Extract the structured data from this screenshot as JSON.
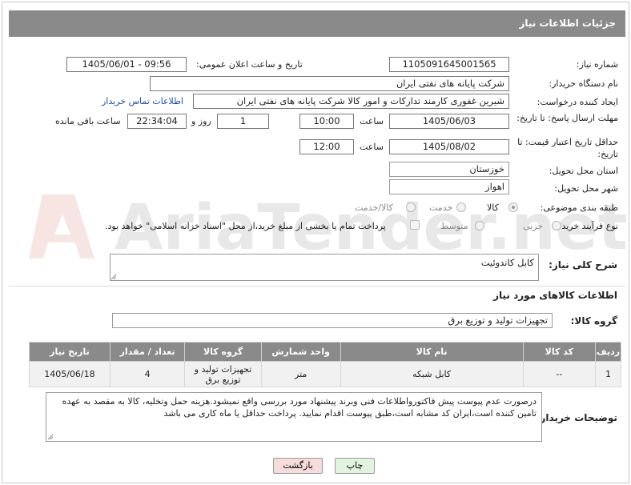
{
  "header": {
    "title": "جزئیات اطلاعات نیاز"
  },
  "form": {
    "need_number_label": "شماره نیاز:",
    "need_number": "1105091645001565",
    "announce_label": "تاریخ و ساعت اعلان عمومی:",
    "announce_value": "1405/06/01 - 09:56",
    "buyer_label": "نام دستگاه خریدار:",
    "buyer_value": "شرکت پایانه های نفتی ایران",
    "creator_label": "ایجاد کننده درخواست:",
    "creator_value": "شیرین غفوری کارمند تدارکات و امور کالا شرکت پایانه های نفتی ایران",
    "buyer_contact_link": "اطلاعات تماس خریدار",
    "reply_deadline_label": "مهلت ارسال پاسخ: تا تاریخ:",
    "reply_date": "1405/06/03",
    "time_label": "ساعت",
    "reply_time": "10:00",
    "days_value": "1",
    "days_label": "روز و",
    "remaining_time": "22:34:04",
    "remaining_label": "ساعت باقی مانده",
    "price_validity_label": "حداقل تاریخ اعتبار قیمت: تا تاریخ:",
    "price_date": "1405/08/02",
    "price_time_label": "ساعت",
    "price_time": "12:00",
    "province_label": "استان محل تحویل:",
    "province_value": "خوزستان",
    "city_label": "شهر محل تحویل:",
    "city_value": "اهواز",
    "category_label": "طبقه بندی موضوعی:",
    "category_options": [
      "کالا",
      "خدمت",
      "کالا/خدمت"
    ],
    "category_selected": "کالا",
    "process_label": "نوع فرآیند خرید :",
    "process_options": [
      "جزیی",
      "متوسط"
    ],
    "payment_note": "پرداخت تمام یا بخشی از مبلغ خرید،از محل \"اسناد خزانه اسلامی\" خواهد بود.",
    "description_label": "شرح کلی نیاز:",
    "description_value": "کابل کاندوئیت",
    "goods_info_label": "اطلاعات کالاهای مورد نیاز",
    "goods_group_label": "گروه کالا:",
    "goods_group_value": "تجهیزات تولید و توزیع برق"
  },
  "table": {
    "headers": [
      "ردیف",
      "کد کالا",
      "نام کالا",
      "واحد شمارش",
      "گروه کالا",
      "تعداد / مقدار",
      "تاریخ نیاز"
    ],
    "rows": [
      [
        "1",
        "--",
        "کابل شبکه",
        "متر",
        "تجهیزات تولید و توزیع برق",
        "4",
        "1405/06/18"
      ]
    ]
  },
  "buyer_notes": {
    "label": "توضیحات خریدار:",
    "text": "درصورت عدم پیوست پیش فاکتورواطلاعات فنی وبرند پیشنهاد مورد بررسی واقع نمیشود.هزینه حمل وتخلیه، کالا به مقصد به عهده تامین کننده است،ایران کد مشابه است،طبق پیوست اقدام نمایید. پرداخت حداقل یا ماه کاری می باشد"
  },
  "buttons": {
    "print": "چاپ",
    "back": "بازگشت"
  },
  "watermark": "AriaTender.net",
  "colors": {
    "header_bg": "#8a8a8a",
    "link": "#1f4fa8",
    "back_button_bg": "#f7dcdc",
    "print_button_bg": "#e2f3df"
  }
}
